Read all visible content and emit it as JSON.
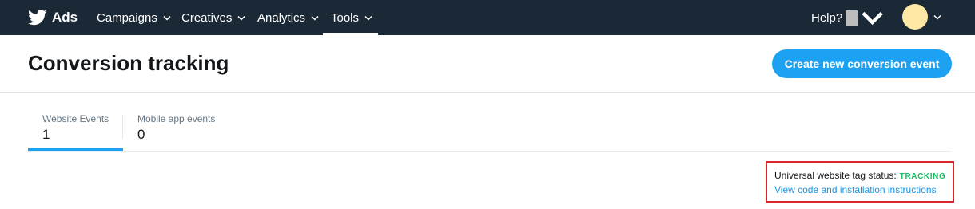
{
  "nav": {
    "brand": "Ads",
    "items": [
      {
        "label": "Campaigns"
      },
      {
        "label": "Creatives"
      },
      {
        "label": "Analytics"
      },
      {
        "label": "Tools"
      }
    ],
    "active_item": "Tools",
    "help_label": "Help?",
    "icons": {
      "brand": "twitter-bird-icon",
      "dropdown": "chevron-down-icon"
    }
  },
  "header": {
    "title": "Conversion tracking",
    "create_button_label": "Create new conversion event"
  },
  "tabs": [
    {
      "label": "Website Events",
      "count": "1",
      "active": true
    },
    {
      "label": "Mobile app events",
      "count": "0",
      "active": false
    }
  ],
  "tag_status": {
    "label": "Universal website tag status:",
    "value": "TRACKING",
    "link": "View code and installation instructions"
  },
  "colors": {
    "nav_bg": "#1b2836",
    "accent": "#1da1f2",
    "tracking_green": "#17bf63",
    "link_blue": "#1b95e0",
    "highlight_red": "#d9262b"
  }
}
